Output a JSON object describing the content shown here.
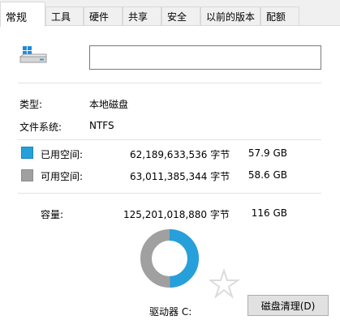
{
  "tabs": [
    {
      "label": "常规",
      "active": true
    },
    {
      "label": "工具"
    },
    {
      "label": "硬件"
    },
    {
      "label": "共享"
    },
    {
      "label": "安全"
    },
    {
      "label": "以前的版本"
    },
    {
      "label": "配额"
    }
  ],
  "drive_name": {
    "value": "",
    "placeholder": ""
  },
  "type": {
    "label": "类型:",
    "value": "本地磁盘"
  },
  "filesystem": {
    "label": "文件系统:",
    "value": "NTFS"
  },
  "used": {
    "label": "已用空间:",
    "bytes": "62,189,633,536 字节",
    "size": "57.9 GB",
    "color": "#26a0da"
  },
  "free": {
    "label": "可用空间:",
    "bytes": "63,011,385,344 字节",
    "size": "58.6 GB",
    "color": "#a0a0a0"
  },
  "capacity": {
    "label": "容量:",
    "bytes": "125,201,018,880 字节",
    "size": "116 GB"
  },
  "usage_fraction": 0.4967,
  "drive_label": "驱动器 C:",
  "cleanup_button": "磁盘清理(D)",
  "watermark_icon": "star-logo-icon"
}
